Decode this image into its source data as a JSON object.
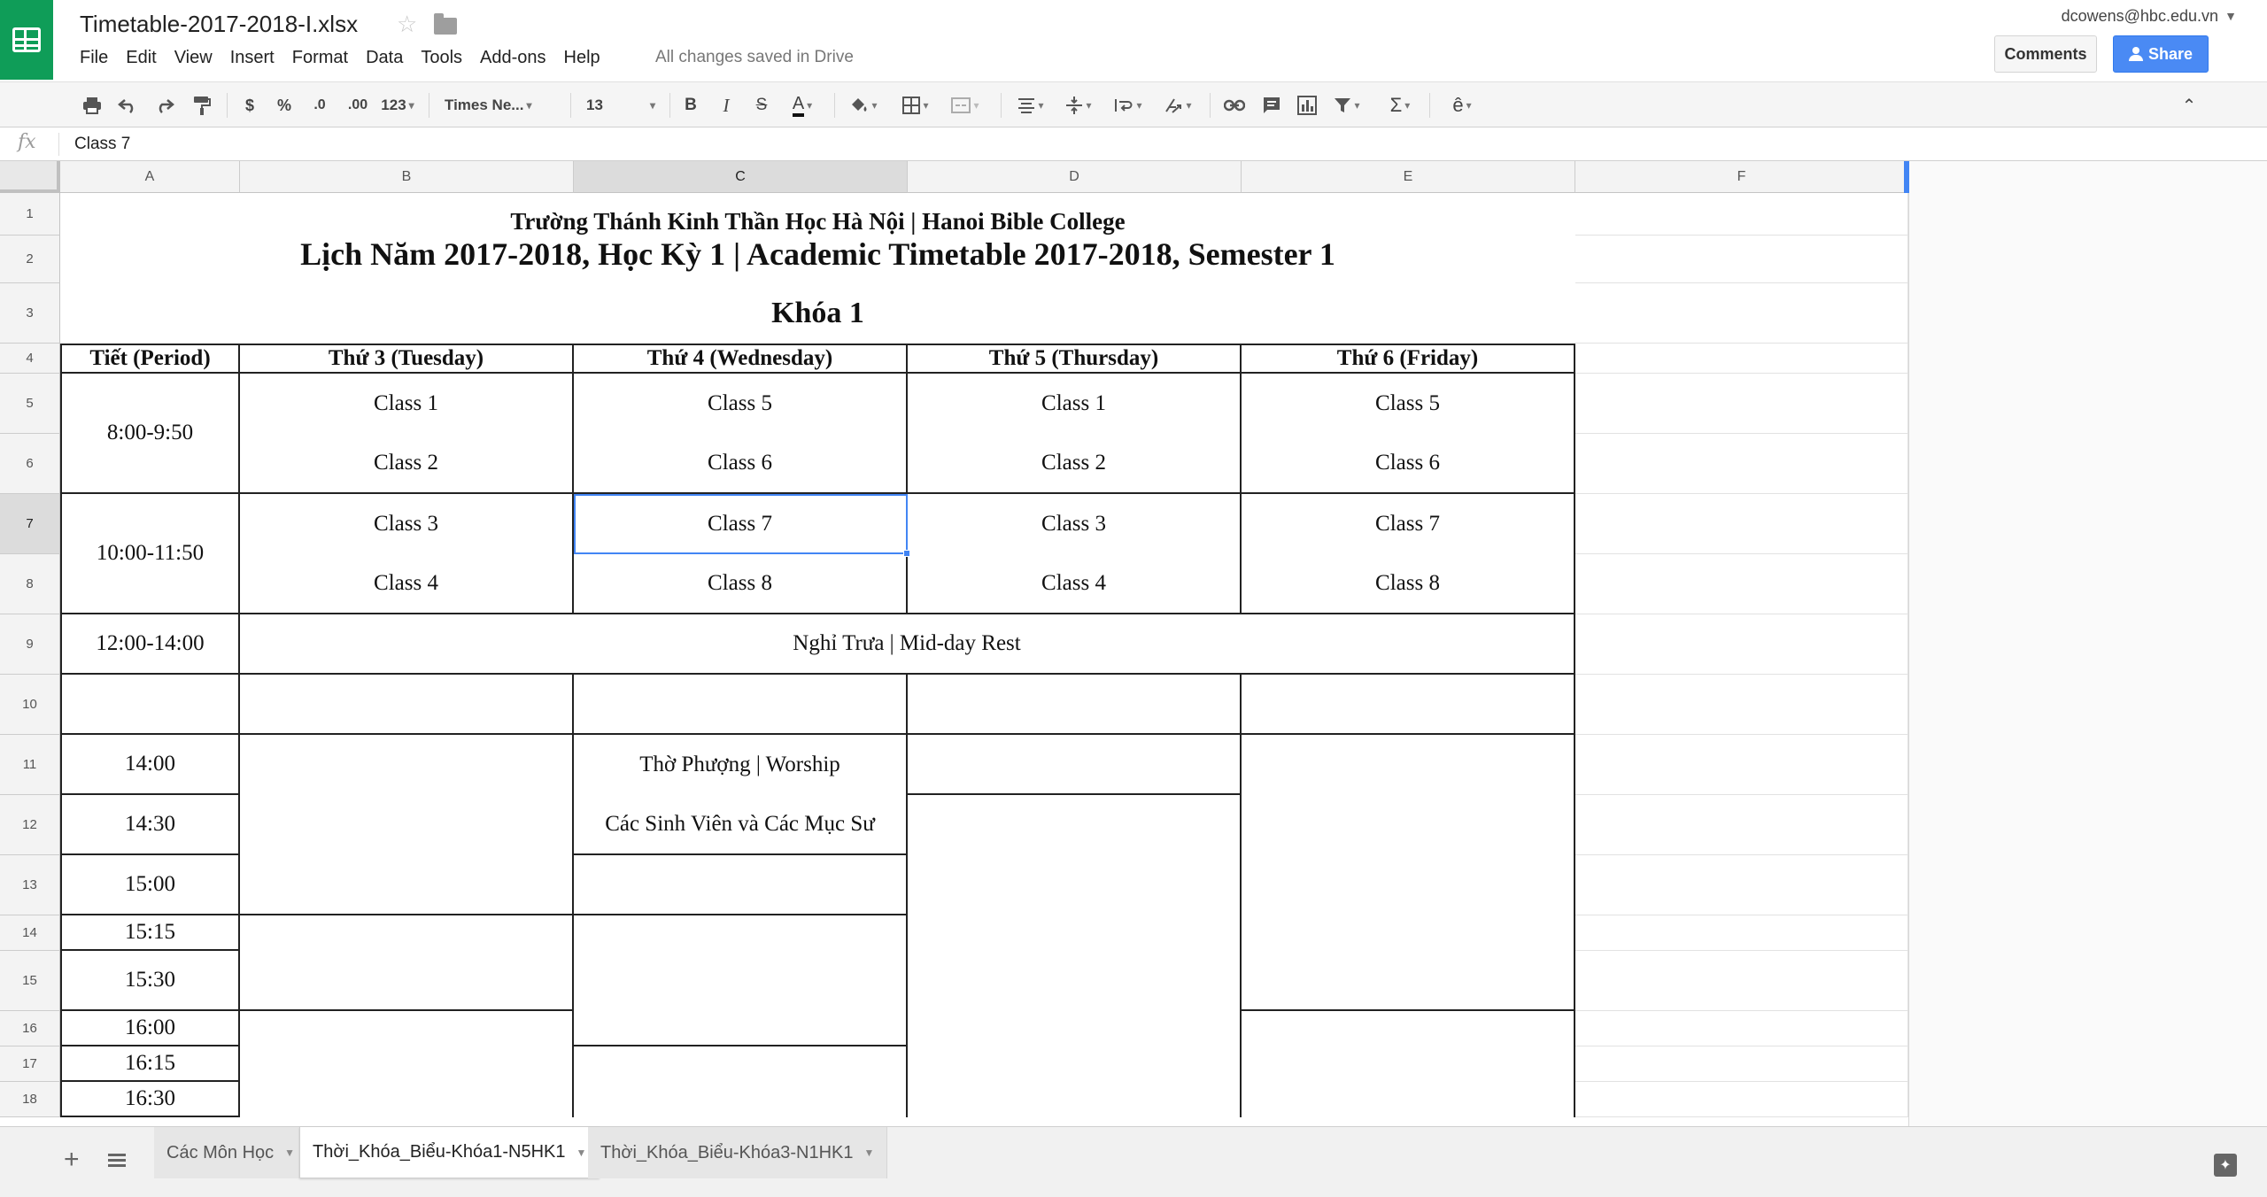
{
  "app": {
    "doc_title": "Timetable-2017-2018-I.xlsx",
    "save_status": "All changes saved in Drive",
    "user_email": "dcowens@hbc.edu.vn",
    "comments_label": "Comments",
    "share_label": "Share",
    "accent_color": "#4285f4",
    "brand_color": "#0f9d58"
  },
  "menu": [
    "File",
    "Edit",
    "View",
    "Insert",
    "Format",
    "Data",
    "Tools",
    "Add-ons",
    "Help"
  ],
  "toolbar": {
    "print_icon": "print-icon",
    "undo_icon": "undo-icon",
    "redo_icon": "redo-icon",
    "paint_format_icon": "paint-format-icon",
    "currency": "$",
    "percent": "%",
    "decrease_decimal": ".0",
    "increase_decimal": ".00",
    "more_formats": "123",
    "font": "Times Ne...",
    "font_size": "13",
    "bold": "B",
    "italic": "I",
    "strikethrough": "S",
    "text_color": "A"
  },
  "formula_bar": {
    "fx": "fx",
    "value": "Class 7"
  },
  "columns": [
    "A",
    "B",
    "C",
    "D",
    "E",
    "F"
  ],
  "rows": [
    "1",
    "2",
    "3",
    "4",
    "5",
    "6",
    "7",
    "8",
    "9",
    "10",
    "11",
    "12",
    "13",
    "14",
    "15",
    "16",
    "17",
    "18"
  ],
  "selected": {
    "column": "C",
    "row": "7"
  },
  "sheet": {
    "school_name": "Trường Thánh Kinh Thần Học Hà Nội | Hanoi Bible College",
    "timetable_title": "Lịch Năm 2017-2018, Học Kỳ 1 | Academic Timetable 2017-2018, Semester 1",
    "course": "Khóa 1",
    "headers": [
      "Tiết (Period)",
      "Thứ 3 (Tuesday)",
      "Thứ 4 (Wednesday)",
      "Thứ 5 (Thursday)",
      "Thứ 6 (Friday)"
    ],
    "period_1": "8:00-9:50",
    "period_2": "10:00-11:50",
    "period_lunch": "12:00-14:00",
    "r5": [
      "Class 1",
      "Class 5",
      "Class 1",
      "Class 5"
    ],
    "r6": [
      "Class 2",
      "Class 6",
      "Class 2",
      "Class 6"
    ],
    "r7": [
      "Class 3",
      "Class 7",
      "Class 3",
      "Class 7"
    ],
    "r8": [
      "Class 4",
      "Class 8",
      "Class 4",
      "Class 8"
    ],
    "lunch": "Nghỉ Trưa | Mid-day Rest",
    "worship": "Thờ Phượng | Worship",
    "worship_sub": "Các Sinh Viên và Các Mục Sư",
    "times": [
      "14:00",
      "14:30",
      "15:00",
      "15:15",
      "15:30",
      "16:00",
      "16:15",
      "16:30"
    ]
  },
  "tabs": [
    {
      "label": "Các Môn Học",
      "active": false
    },
    {
      "label": "Thời_Khóa_Biểu-Khóa1-N5HK1",
      "active": true
    },
    {
      "label": "Thời_Khóa_Biểu-Khóa3-N1HK1",
      "active": false
    }
  ]
}
